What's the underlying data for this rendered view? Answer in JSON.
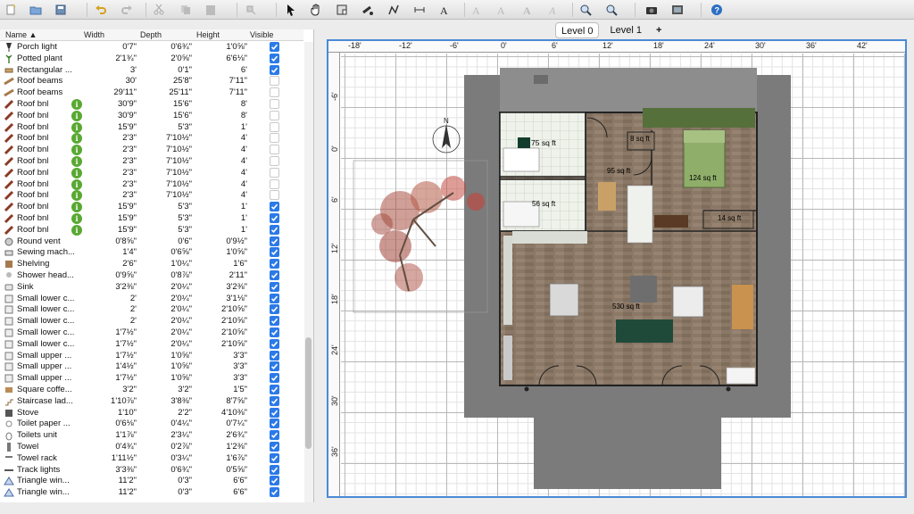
{
  "toolbar": {
    "icons": [
      "new-home-icon",
      "open-icon",
      "save-icon",
      "undo-icon",
      "redo-icon",
      "cut-icon",
      "copy-icon",
      "paste-icon",
      "add-furniture-icon",
      "select-icon",
      "pan-icon",
      "create-rooms-icon",
      "create-walls-icon",
      "create-polylines-icon",
      "create-dimensions-icon",
      "add-text-icon",
      "text-style-1-icon",
      "text-style-2-icon",
      "bold-icon",
      "italic-icon",
      "zoom-in-icon",
      "zoom-out-icon",
      "create-photo-icon",
      "create-video-icon",
      "help-icon"
    ]
  },
  "table": {
    "headers": {
      "name": "Name ▲",
      "width": "Width",
      "depth": "Depth",
      "height": "Height",
      "visible": "Visible"
    },
    "rows": [
      {
        "name": "Porch light",
        "w": "0'7\"",
        "d": "0'6¾\"",
        "h": "1'0⅝\"",
        "v": true,
        "info": false,
        "icon": "lamp"
      },
      {
        "name": "Potted plant",
        "w": "2'1¾\"",
        "d": "2'0⅝\"",
        "h": "6'6⅛\"",
        "v": true,
        "info": false,
        "icon": "plant"
      },
      {
        "name": "Rectangular ...",
        "w": "3'",
        "d": "0'1\"",
        "h": "6'",
        "v": true,
        "info": false,
        "icon": "rect"
      },
      {
        "name": "Roof beams",
        "w": "30'",
        "d": "25'8\"",
        "h": "7'11\"",
        "v": false,
        "info": false,
        "icon": "beam"
      },
      {
        "name": "Roof beams",
        "w": "29'11\"",
        "d": "25'11\"",
        "h": "7'11\"",
        "v": false,
        "info": false,
        "icon": "beam"
      },
      {
        "name": "Roof bnl",
        "w": "30'9\"",
        "d": "15'6\"",
        "h": "8'",
        "v": false,
        "info": true,
        "icon": "roof"
      },
      {
        "name": "Roof bnl",
        "w": "30'9\"",
        "d": "15'6\"",
        "h": "8'",
        "v": false,
        "info": true,
        "icon": "roof"
      },
      {
        "name": "Roof bnl",
        "w": "15'9\"",
        "d": "5'3\"",
        "h": "1'",
        "v": false,
        "info": true,
        "icon": "roof"
      },
      {
        "name": "Roof bnl",
        "w": "2'3\"",
        "d": "7'10½\"",
        "h": "4'",
        "v": false,
        "info": true,
        "icon": "roof"
      },
      {
        "name": "Roof bnl",
        "w": "2'3\"",
        "d": "7'10½\"",
        "h": "4'",
        "v": false,
        "info": true,
        "icon": "roof"
      },
      {
        "name": "Roof bnl",
        "w": "2'3\"",
        "d": "7'10½\"",
        "h": "4'",
        "v": false,
        "info": true,
        "icon": "roof"
      },
      {
        "name": "Roof bnl",
        "w": "2'3\"",
        "d": "7'10½\"",
        "h": "4'",
        "v": false,
        "info": true,
        "icon": "roof"
      },
      {
        "name": "Roof bnl",
        "w": "2'3\"",
        "d": "7'10½\"",
        "h": "4'",
        "v": false,
        "info": true,
        "icon": "roof"
      },
      {
        "name": "Roof bnl",
        "w": "2'3\"",
        "d": "7'10½\"",
        "h": "4'",
        "v": false,
        "info": true,
        "icon": "roof"
      },
      {
        "name": "Roof bnl",
        "w": "15'9\"",
        "d": "5'3\"",
        "h": "1'",
        "v": true,
        "info": true,
        "icon": "roof"
      },
      {
        "name": "Roof bnl",
        "w": "15'9\"",
        "d": "5'3\"",
        "h": "1'",
        "v": true,
        "info": true,
        "icon": "roof"
      },
      {
        "name": "Roof bnl",
        "w": "15'9\"",
        "d": "5'3\"",
        "h": "1'",
        "v": true,
        "info": true,
        "icon": "roof"
      },
      {
        "name": "Round vent",
        "w": "0'8⅝\"",
        "d": "0'6\"",
        "h": "0'9½\"",
        "v": true,
        "info": false,
        "icon": "vent"
      },
      {
        "name": "Sewing mach...",
        "w": "1'4\"",
        "d": "0'6⅝\"",
        "h": "1'0⅝\"",
        "v": true,
        "info": false,
        "icon": "sewing"
      },
      {
        "name": "Shelving",
        "w": "2'6\"",
        "d": "1'0¼\"",
        "h": "1'6\"",
        "v": true,
        "info": false,
        "icon": "shelf"
      },
      {
        "name": "Shower head...",
        "w": "0'9⅝\"",
        "d": "0'8⅞\"",
        "h": "2'11\"",
        "v": true,
        "info": false,
        "icon": "shower"
      },
      {
        "name": "Sink",
        "w": "3'2⅜\"",
        "d": "2'0¼\"",
        "h": "3'2⅜\"",
        "v": true,
        "info": false,
        "icon": "sink"
      },
      {
        "name": "Small lower c...",
        "w": "2'",
        "d": "2'0¼\"",
        "h": "3'1⅛\"",
        "v": true,
        "info": false,
        "icon": "cabinet"
      },
      {
        "name": "Small lower c...",
        "w": "2'",
        "d": "2'0¼\"",
        "h": "2'10⅝\"",
        "v": true,
        "info": false,
        "icon": "cabinet"
      },
      {
        "name": "Small lower c...",
        "w": "2'",
        "d": "2'0¼\"",
        "h": "2'10⅝\"",
        "v": true,
        "info": false,
        "icon": "cabinet"
      },
      {
        "name": "Small lower c...",
        "w": "1'7½\"",
        "d": "2'0¼\"",
        "h": "2'10⅝\"",
        "v": true,
        "info": false,
        "icon": "cabinet"
      },
      {
        "name": "Small lower c...",
        "w": "1'7½\"",
        "d": "2'0¼\"",
        "h": "2'10⅝\"",
        "v": true,
        "info": false,
        "icon": "cabinet"
      },
      {
        "name": "Small upper ...",
        "w": "1'7½\"",
        "d": "1'0⅝\"",
        "h": "3'3\"",
        "v": true,
        "info": false,
        "icon": "cabinet"
      },
      {
        "name": "Small upper ...",
        "w": "1'4½\"",
        "d": "1'0⅝\"",
        "h": "3'3\"",
        "v": true,
        "info": false,
        "icon": "cabinet"
      },
      {
        "name": "Small upper ...",
        "w": "1'7½\"",
        "d": "1'0⅝\"",
        "h": "3'3\"",
        "v": true,
        "info": false,
        "icon": "cabinet"
      },
      {
        "name": "Square coffe...",
        "w": "3'2\"",
        "d": "3'2\"",
        "h": "1'5\"",
        "v": true,
        "info": false,
        "icon": "table"
      },
      {
        "name": "Staircase lad...",
        "w": "1'10⅞\"",
        "d": "3'8⅜\"",
        "h": "8'7⅝\"",
        "v": true,
        "info": false,
        "icon": "stairs"
      },
      {
        "name": "Stove",
        "w": "1'10\"",
        "d": "2'2\"",
        "h": "4'10⅜\"",
        "v": true,
        "info": false,
        "icon": "stove"
      },
      {
        "name": "Toilet paper ...",
        "w": "0'6⅛\"",
        "d": "0'4¼\"",
        "h": "0'7¼\"",
        "v": true,
        "info": false,
        "icon": "paper"
      },
      {
        "name": "Toilets unit",
        "w": "1'1⅞\"",
        "d": "2'3¼\"",
        "h": "2'6¾\"",
        "v": true,
        "info": false,
        "icon": "toilet"
      },
      {
        "name": "Towel",
        "w": "0'4¾\"",
        "d": "0'2⅞\"",
        "h": "1'2⅜\"",
        "v": true,
        "info": false,
        "icon": "towel"
      },
      {
        "name": "Towel rack",
        "w": "1'11½\"",
        "d": "0'3¼\"",
        "h": "1'6⅞\"",
        "v": true,
        "info": false,
        "icon": "rack"
      },
      {
        "name": "Track lights",
        "w": "3'3⅜\"",
        "d": "0'6¾\"",
        "h": "0'5⅝\"",
        "v": true,
        "info": false,
        "icon": "track"
      },
      {
        "name": "Triangle win...",
        "w": "11'2\"",
        "d": "0'3\"",
        "h": "6'6\"",
        "v": true,
        "info": false,
        "icon": "window"
      },
      {
        "name": "Triangle win...",
        "w": "11'2\"",
        "d": "0'3\"",
        "h": "6'6\"",
        "v": true,
        "info": false,
        "icon": "window"
      }
    ]
  },
  "levels": {
    "tabs": [
      "Level 0",
      "Level 1"
    ],
    "add": "+",
    "active": 0
  },
  "ruler": {
    "top": [
      "-18'",
      "-12'",
      "-6'",
      "0'",
      "6'",
      "12'",
      "18'",
      "24'",
      "30'",
      "36'",
      "42'"
    ],
    "left": [
      "-6'",
      "0'",
      "6'",
      "12'",
      "18'",
      "24'",
      "30'",
      "36'"
    ]
  },
  "plan": {
    "compass": "N",
    "rooms": [
      "75 sq ft",
      "8 sq ft",
      "95 sq ft",
      "124 sq ft",
      "56 sq ft",
      "14 sq ft",
      "530 sq ft"
    ],
    "colors": {
      "roof": "#7b7b7b",
      "floor": "#8a7763",
      "wall": "#222222",
      "selection": "#4a8ad6"
    }
  }
}
